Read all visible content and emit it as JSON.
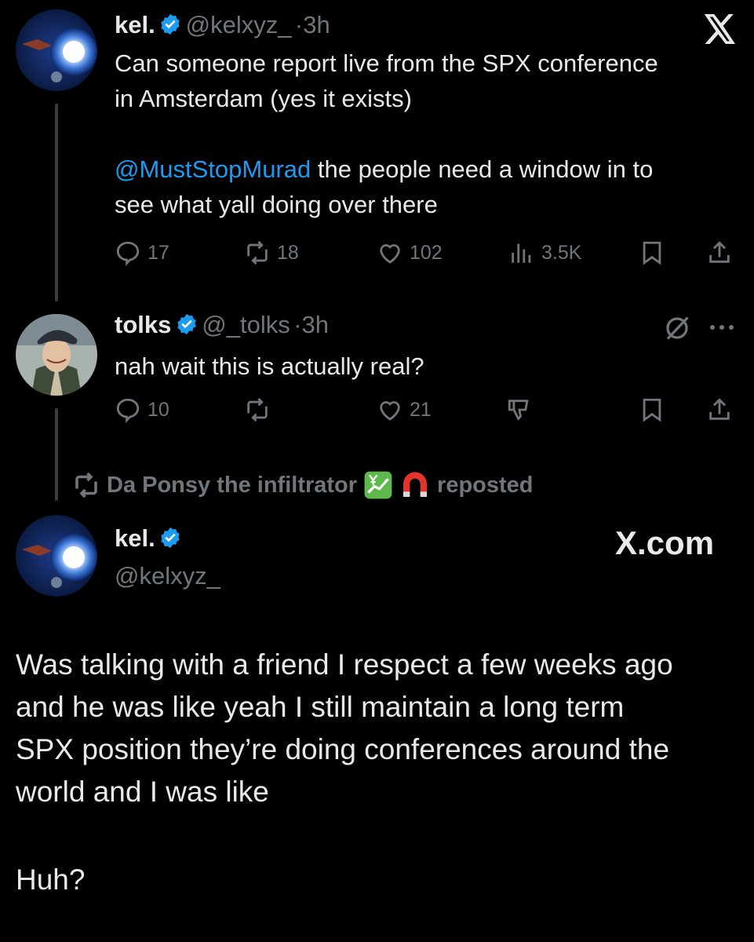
{
  "thread": [
    {
      "author": {
        "name": "kel.",
        "handle": "@kelxyz_",
        "separator": "·",
        "time": "3h",
        "avatar_icon": "moon-orb-avatar"
      },
      "text_line1": "Can someone report live from the SPX conference",
      "text_line2": "in Amsterdam (yes it exists)",
      "mention": "@MustStopMurad",
      "text_after_mention": " the people need a window in to",
      "text_line4": "see what yall doing over there",
      "actions": {
        "replies": "17",
        "reposts": "18",
        "likes": "102",
        "views": "3.5K"
      },
      "top_right_icon": "x-logo-icon"
    },
    {
      "author": {
        "name": "tolks",
        "handle": "@_tolks",
        "separator": "·",
        "time": "3h",
        "avatar_icon": "cartoon-avatar"
      },
      "text": "nah wait this is actually real?",
      "actions": {
        "replies": "10",
        "reposts": "",
        "likes": "21"
      },
      "top_right_icons": [
        "grok-icon",
        "more-icon"
      ]
    }
  ],
  "repost_banner": {
    "name": "Da Ponsy the infiltrator",
    "suffix": "reposted",
    "emoji_icons": [
      "chart-yen-icon",
      "magnet-icon"
    ]
  },
  "quoted_post": {
    "author": {
      "name": "kel.",
      "handle": "@kelxyz_"
    },
    "watermark": "X.com",
    "lines": [
      "Was talking with a friend I respect a few weeks ago",
      "and he was like yeah I still maintain a long term",
      "SPX position they’re doing conferences around the",
      "world and I was like"
    ],
    "closing": "Huh?"
  },
  "colors": {
    "background": "#000000",
    "text": "#e7e9ea",
    "muted": "#71767b",
    "accent": "#1d9bf0",
    "verified": "#1d9bf0"
  }
}
